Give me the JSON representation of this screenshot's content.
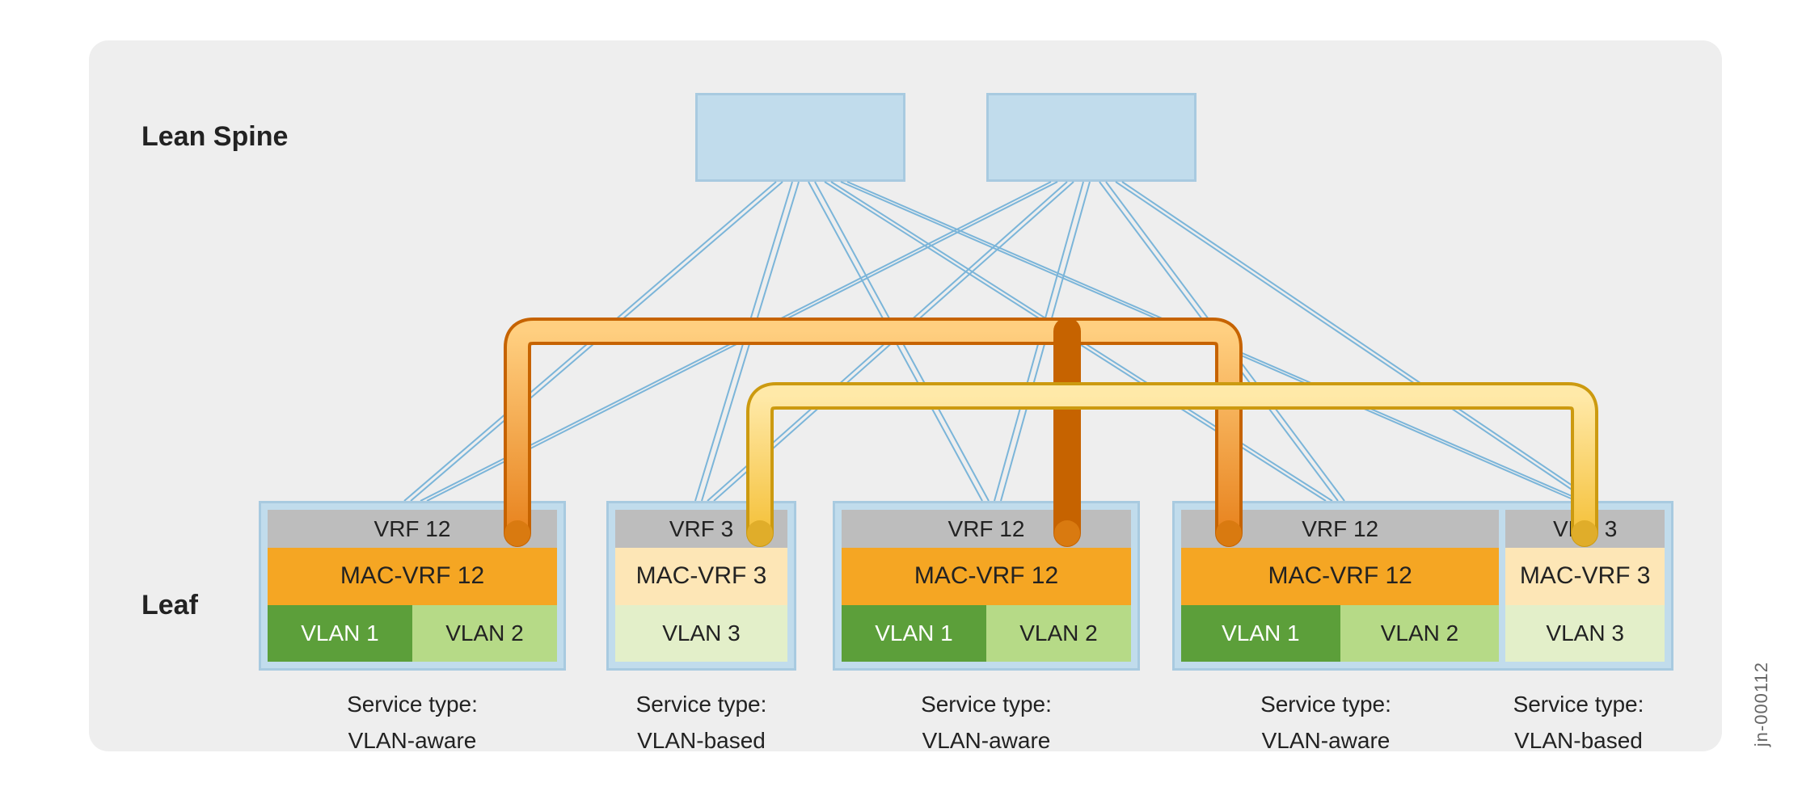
{
  "tiers": {
    "spine": "Lean Spine",
    "leaf": "Leaf"
  },
  "spines": [
    {
      "id": "spine-1"
    },
    {
      "id": "spine-2"
    }
  ],
  "leaves": {
    "a": {
      "vrf": "VRF 12",
      "mac": "MAC-VRF 12",
      "vlans": [
        {
          "label": "VLAN 1",
          "shade": "dark"
        },
        {
          "label": "VLAN 2",
          "shade": "light"
        }
      ],
      "service_line1": "Service type:",
      "service_line2": "VLAN-aware"
    },
    "b": {
      "vrf": "VRF 3",
      "mac": "MAC-VRF 3",
      "vlans": [
        {
          "label": "VLAN 3",
          "shade": "pale"
        }
      ],
      "service_line1": "Service type:",
      "service_line2": "VLAN-based"
    },
    "c": {
      "vrf": "VRF 12",
      "mac": "MAC-VRF 12",
      "vlans": [
        {
          "label": "VLAN 1",
          "shade": "dark"
        },
        {
          "label": "VLAN 2",
          "shade": "light"
        }
      ],
      "service_line1": "Service type:",
      "service_line2": "VLAN-aware"
    },
    "d_left": {
      "vrf": "VRF 12",
      "mac": "MAC-VRF 12",
      "vlans": [
        {
          "label": "VLAN 1",
          "shade": "dark"
        },
        {
          "label": "VLAN 2",
          "shade": "light"
        }
      ],
      "service_line1": "Service type:",
      "service_line2": "VLAN-aware"
    },
    "d_right": {
      "vrf": "VRF 3",
      "mac": "MAC-VRF 3",
      "vlans": [
        {
          "label": "VLAN 3",
          "shade": "pale"
        }
      ],
      "service_line1": "Service type:",
      "service_line2": "VLAN-based"
    }
  },
  "tunnels": {
    "orange": {
      "color": "#e8831e",
      "gloss": "#ffcf80",
      "endpoints": [
        "leaf-a.vrf12",
        "leaf-c.vrf12",
        "leaf-d.vrf12"
      ]
    },
    "yellow": {
      "color": "#f5c13a",
      "gloss": "#ffe9a8",
      "endpoints": [
        "leaf-b.vrf3",
        "leaf-d.vrf3"
      ]
    }
  },
  "image_id": "jn-000112"
}
